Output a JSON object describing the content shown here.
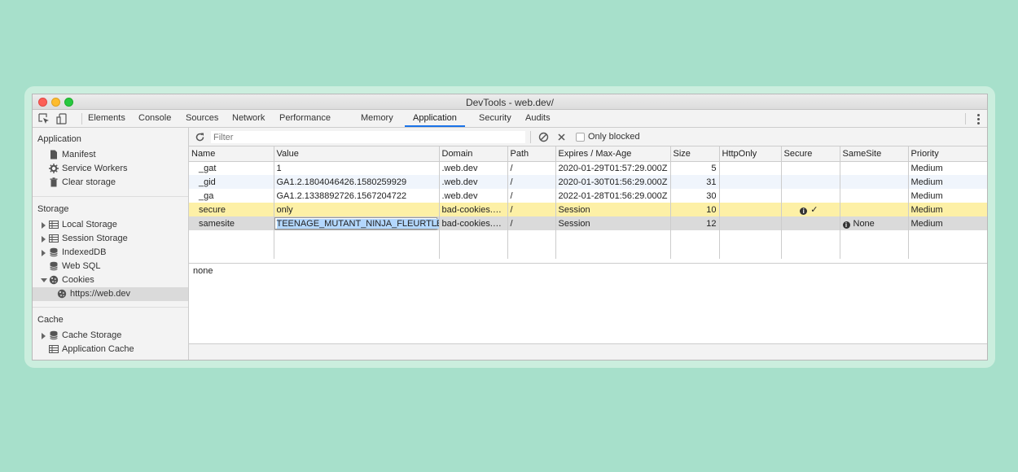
{
  "window": {
    "title": "DevTools - web.dev/"
  },
  "tabs": [
    "Elements",
    "Console",
    "Sources",
    "Network",
    "Performance",
    "Memory",
    "Application",
    "Security",
    "Audits"
  ],
  "active_tab": "Application",
  "sidebar": {
    "application_header": "Application",
    "application_items": [
      {
        "label": "Manifest",
        "icon": "document-icon"
      },
      {
        "label": "Service Workers",
        "icon": "gear-icon"
      },
      {
        "label": "Clear storage",
        "icon": "trash-icon"
      }
    ],
    "storage_header": "Storage",
    "storage_items": [
      {
        "label": "Local Storage",
        "icon": "grid-icon",
        "expand": "collapsed"
      },
      {
        "label": "Session Storage",
        "icon": "grid-icon",
        "expand": "collapsed"
      },
      {
        "label": "IndexedDB",
        "icon": "database-icon",
        "expand": "collapsed"
      },
      {
        "label": "Web SQL",
        "icon": "database-icon",
        "expand": "none"
      },
      {
        "label": "Cookies",
        "icon": "cookie-icon",
        "expand": "expanded"
      },
      {
        "label": "https://web.dev",
        "icon": "cookie-icon",
        "expand": "child",
        "selected": true
      }
    ],
    "cache_header": "Cache",
    "cache_items": [
      {
        "label": "Cache Storage",
        "icon": "database-icon",
        "expand": "collapsed"
      },
      {
        "label": "Application Cache",
        "icon": "grid-icon",
        "expand": "none"
      }
    ]
  },
  "toolbar": {
    "filter_placeholder": "Filter",
    "only_blocked_label": "Only blocked",
    "only_blocked_checked": false
  },
  "table": {
    "columns": [
      "Name",
      "Value",
      "Domain",
      "Path",
      "Expires / Max-Age",
      "Size",
      "HttpOnly",
      "Secure",
      "SameSite",
      "Priority"
    ],
    "rows": [
      {
        "name": "_gat",
        "value": "1",
        "domain": ".web.dev",
        "path": "/",
        "expires": "2020-01-29T01:57:29.000Z",
        "size": "5",
        "httponly": "",
        "secure": "",
        "samesite": "",
        "priority": "Medium",
        "state": "normal"
      },
      {
        "name": "_gid",
        "value": "GA1.2.1804046426.1580259929",
        "domain": ".web.dev",
        "path": "/",
        "expires": "2020-01-30T01:56:29.000Z",
        "size": "31",
        "httponly": "",
        "secure": "",
        "samesite": "",
        "priority": "Medium",
        "state": "alt"
      },
      {
        "name": "_ga",
        "value": "GA1.2.1338892726.1567204722",
        "domain": ".web.dev",
        "path": "/",
        "expires": "2022-01-28T01:56:29.000Z",
        "size": "30",
        "httponly": "",
        "secure": "",
        "samesite": "",
        "priority": "Medium",
        "state": "normal"
      },
      {
        "name": "secure",
        "value": "only",
        "domain": "bad-cookies.glitch.me",
        "path": "/",
        "expires": "Session",
        "size": "10",
        "httponly": "",
        "secure": "✓",
        "secure_warning": true,
        "samesite": "",
        "priority": "Medium",
        "state": "highlight"
      },
      {
        "name": "samesite",
        "value": "TEENAGE_MUTANT_NINJA_FLEURTLES",
        "domain": "bad-cookies.glitch.me",
        "path": "/",
        "expires": "Session",
        "size": "12",
        "httponly": "",
        "secure": "",
        "samesite": "None",
        "samesite_warning": true,
        "priority": "Medium",
        "state": "selected",
        "editing_value": true
      }
    ]
  },
  "preview_value": "none",
  "colors": {
    "accent": "#1a73e8",
    "highlight_row": "#fdf0a6",
    "selected_row": "#dadada",
    "background": "#a7e0cb"
  }
}
